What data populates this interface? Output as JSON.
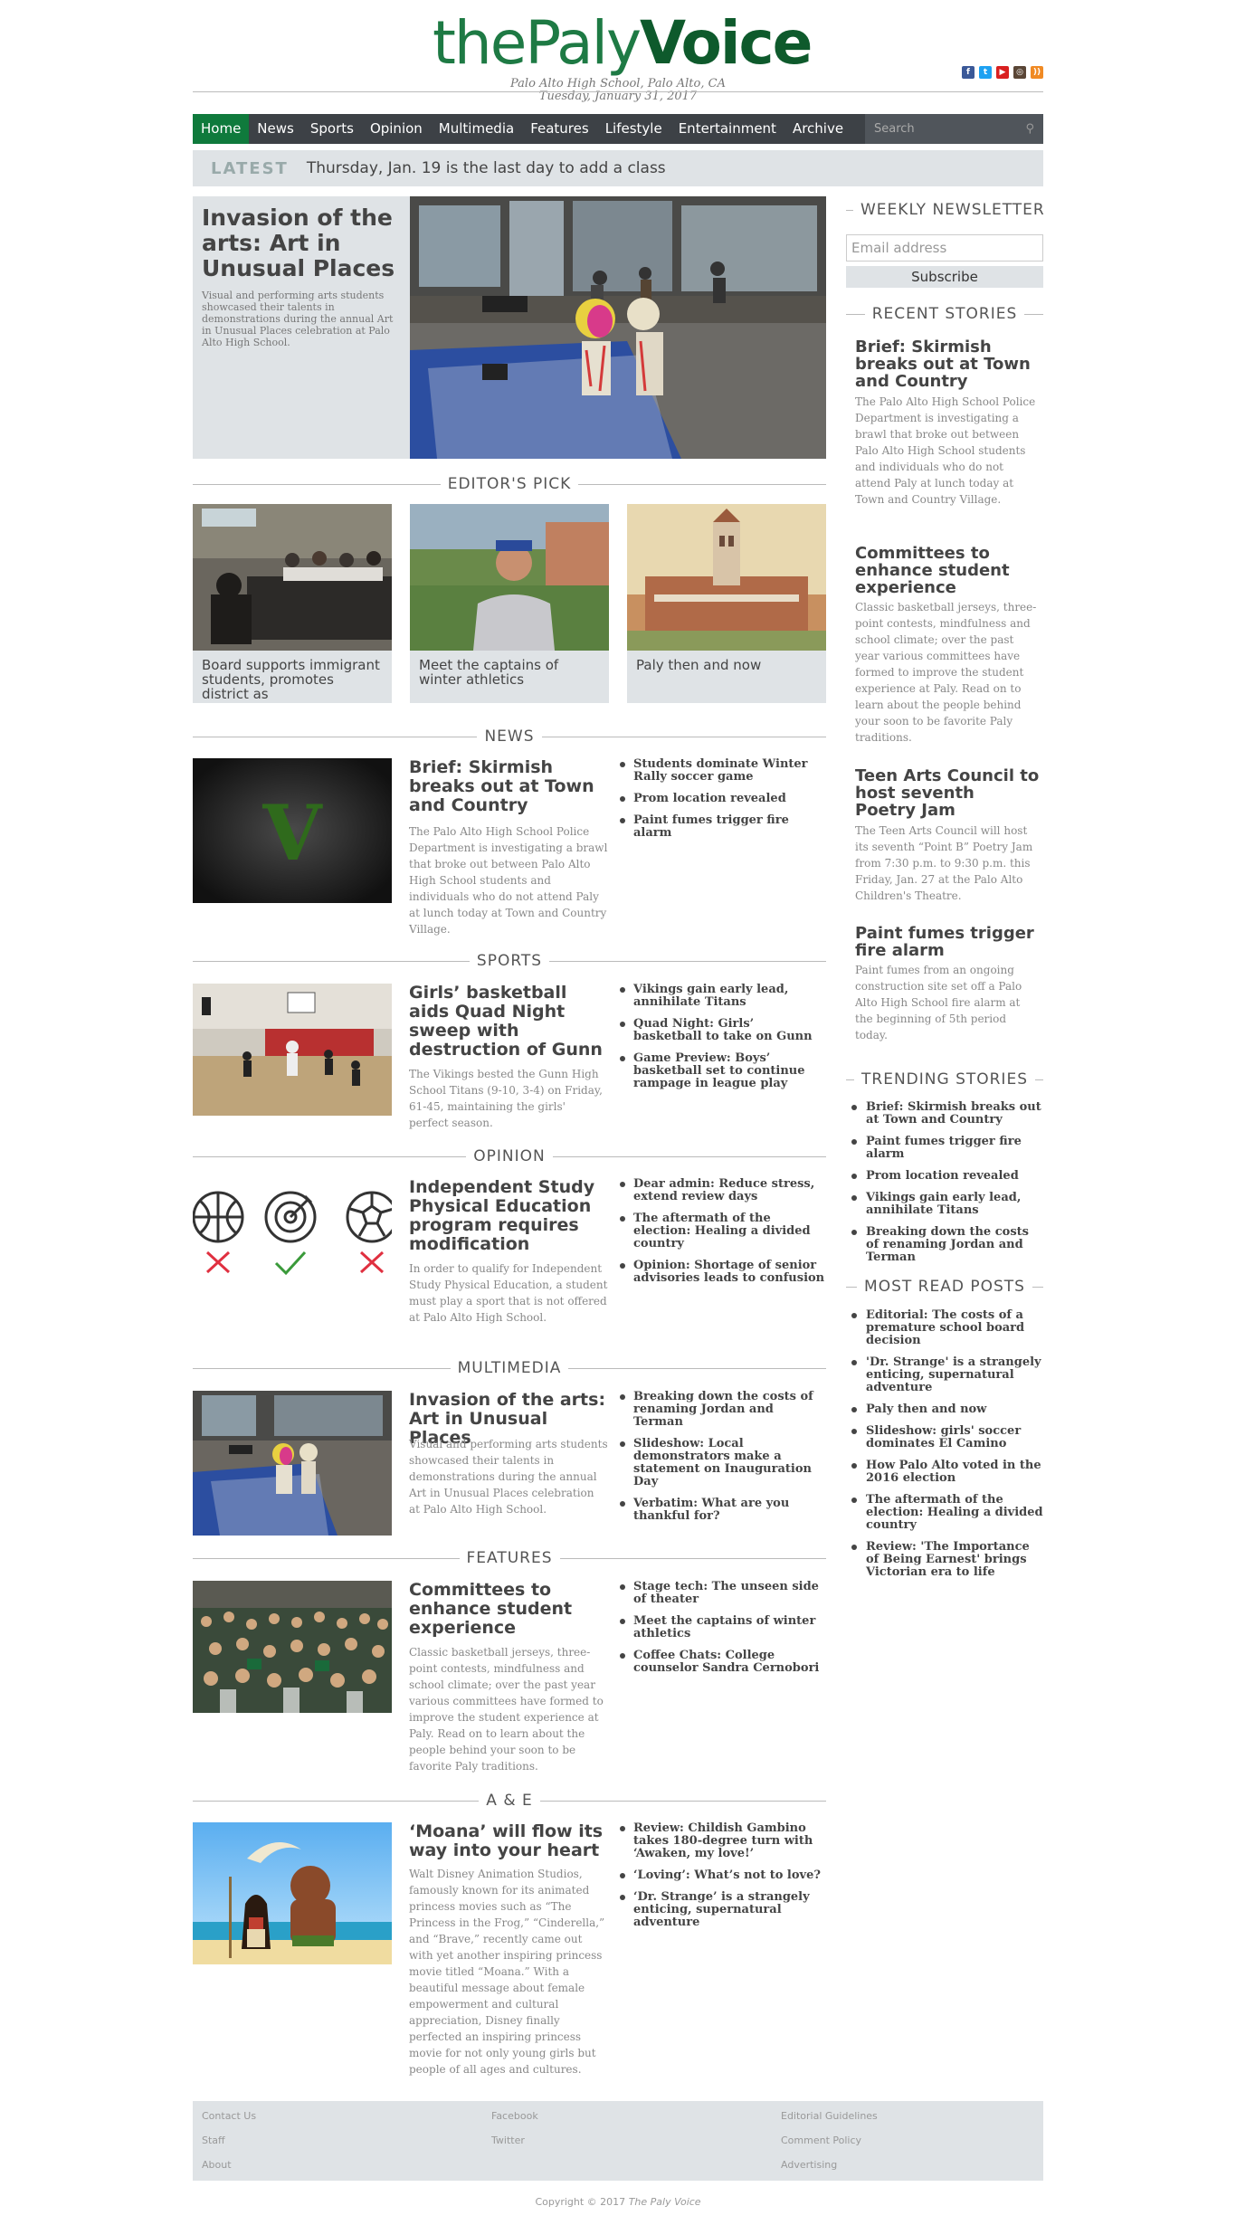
{
  "header": {
    "logo_the": "the",
    "logo_paly": "Paly",
    "logo_voice": "Voice",
    "location": "Palo Alto High School, Palo Alto, CA",
    "date": "Tuesday, January 31, 2017"
  },
  "social": [
    "facebook-icon",
    "twitter-icon",
    "youtube-icon",
    "instagram-icon",
    "rss-icon"
  ],
  "nav": {
    "items": [
      "Home",
      "News",
      "Sports",
      "Opinion",
      "Multimedia",
      "Features",
      "Lifestyle",
      "Entertainment",
      "Archive"
    ],
    "search_placeholder": "Search"
  },
  "latest": {
    "label": "LATEST",
    "text": "Thursday, Jan. 19 is the last day to add a class"
  },
  "hero": {
    "title": "Invasion of the arts: Art in Unusual Places",
    "summary": "Visual and performing arts students showcased their talents in demonstrations during the annual Art in Unusual Places celebration at Palo Alto High School."
  },
  "editors_pick": {
    "heading": "EDITOR'S PICK",
    "items": [
      {
        "caption": "Board supports immigrant students, promotes district as"
      },
      {
        "caption": "Meet the captains of winter athletics"
      },
      {
        "caption": "Paly then and now"
      }
    ]
  },
  "sections": {
    "news": {
      "heading": "NEWS",
      "title": "Brief: Skirmish breaks out at Town and Country",
      "summary": "The Palo Alto High School Police Department is investigating a brawl that broke out between Palo Alto High School students and individuals who do not attend Paly at lunch today at Town and Country Village.",
      "links": [
        "Students dominate Winter Rally soccer game",
        "Prom location revealed",
        "Paint fumes trigger fire alarm"
      ]
    },
    "sports": {
      "heading": "SPORTS",
      "title": "Girls’ basketball aids Quad Night sweep with destruction of Gunn",
      "summary": "The Vikings bested the Gunn High School Titans (9-10, 3-4) on Friday, 61-45, maintaining the girls' perfect season.",
      "links": [
        "Vikings gain early lead, annihilate Titans",
        "Quad Night: Girls’ basketball to take on Gunn",
        "Game Preview: Boys’ basketball set to continue rampage in league play"
      ]
    },
    "opinion": {
      "heading": "OPINION",
      "title": "Independent Study Physical Education program requires modification",
      "summary": "In order to qualify for Independent Study Physical Education, a student must play a sport that is not offered at Palo Alto High School.",
      "links": [
        "Dear admin: Reduce stress, extend review days",
        "The aftermath of the election: Healing a divided country",
        "Opinion: Shortage of senior advisories leads to confusion"
      ]
    },
    "multimedia": {
      "heading": "MULTIMEDIA",
      "title": "Invasion of the arts: Art in Unusual Places",
      "summary": "Visual and performing arts students showcased their talents in demonstrations during the annual Art in Unusual Places celebration at Palo Alto High School.",
      "links": [
        "Breaking down the costs of renaming Jordan and Terman",
        "Slideshow: Local demonstrators make a statement on Inauguration Day",
        "Verbatim: What are you thankful for?"
      ]
    },
    "features": {
      "heading": "FEATURES",
      "title": "Committees to enhance student experience",
      "summary": "Classic basketball jerseys, three-point contests, mindfulness and school climate; over the past year various committees have formed to improve the student experience at Paly. Read on to learn about the people behind your soon to be favorite Paly traditions.",
      "links": [
        "Stage tech: The unseen side of theater",
        "Meet the captains of winter athletics",
        "Coffee Chats: College counselor Sandra Cernobori"
      ]
    },
    "ae": {
      "heading": "A & E",
      "title": "‘Moana’ will flow its way into your heart",
      "summary": "Walt Disney Animation Studios, famously known for its animated princess movies such as “The Princess in the Frog,” “Cinderella,” and “Brave,” recently came out with yet another inspiring princess movie titled “Moana.” With a beautiful message about female empowerment and cultural appreciation, Disney finally perfected an inspiring princess movie for not only young girls but people of all ages and cultures.",
      "links": [
        "Review: Childish Gambino takes 180-degree turn with ‘Awaken, my love!’",
        "‘Loving’: What’s not to love?",
        "‘Dr. Strange’ is a strangely enticing, supernatural adventure"
      ]
    }
  },
  "sidebar": {
    "newsletter_title": "WEEKLY NEWSLETTER",
    "email_placeholder": "Email address",
    "subscribe_label": "Subscribe",
    "recent_title": "RECENT STORIES",
    "recent": [
      {
        "title": "Brief: Skirmish breaks out at Town and Country",
        "summary": "The Palo Alto High School Police Department is investigating a brawl that broke out between Palo Alto High School students and individuals who do not attend Paly at lunch today at Town and Country Village."
      },
      {
        "title": "Committees to enhance student experience",
        "summary": "Classic basketball jerseys, three-point contests, mindfulness and school climate; over the past year various committees have formed to improve the student experience at Paly. Read on to learn about the people behind your soon to be favorite Paly traditions."
      },
      {
        "title": "Teen Arts Council to host seventh Poetry Jam",
        "summary": "The Teen Arts Council will host its seventh “Point B” Poetry Jam from 7:30 p.m. to 9:30 p.m. this Friday, Jan. 27 at the Palo Alto Children's Theatre."
      },
      {
        "title": "Paint fumes trigger fire alarm",
        "summary": "Paint fumes from an ongoing construction site set off a Palo Alto High School fire alarm at the beginning of 5th period today."
      }
    ],
    "trending_title": "TRENDING STORIES",
    "trending": [
      "Brief: Skirmish breaks out at Town and Country",
      "Paint fumes trigger fire alarm",
      "Prom location revealed",
      "Vikings gain early lead, annihilate Titans",
      "Breaking down the costs of renaming Jordan and Terman"
    ],
    "mostread_title": "MOST READ POSTS",
    "mostread": [
      "Editorial: The costs of a premature school board decision",
      "'Dr. Strange' is a strangely enticing, supernatural adventure",
      "Paly then and now",
      "Slideshow: girls' soccer dominates El Camino",
      "How Palo Alto voted in the 2016 election",
      "The aftermath of the election: Healing a divided country",
      "Review: 'The Importance of Being Earnest' brings Victorian era to life"
    ]
  },
  "footer": {
    "col1": [
      "Contact Us",
      "Staff",
      "About"
    ],
    "col2": [
      "Facebook",
      "Twitter"
    ],
    "col3": [
      "Editorial Guidelines",
      "Comment Policy",
      "Advertising"
    ],
    "copyright": "Copyright © 2017",
    "copyright_pub": "The Paly Voice"
  },
  "colors": {
    "brand_green": "#0e5a2c",
    "nav_bg": "#3d4146",
    "nav_active": "#0f7a3c",
    "panel_gray": "#dfe3e6"
  }
}
